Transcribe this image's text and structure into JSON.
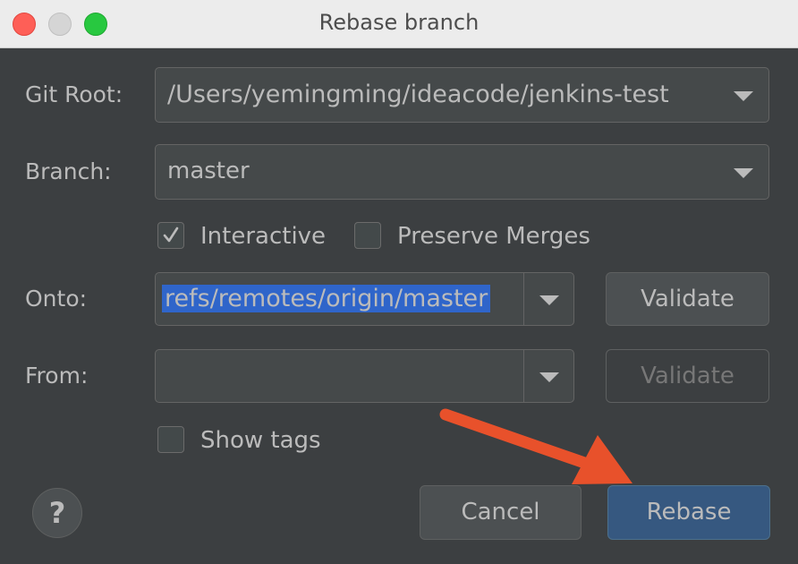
{
  "window": {
    "title": "Rebase branch"
  },
  "git_root": {
    "label": "Git Root:",
    "value": "/Users/yemingming/ideacode/jenkins-test"
  },
  "branch": {
    "label": "Branch:",
    "value": "master"
  },
  "options": {
    "interactive": {
      "label": "Interactive",
      "checked": true
    },
    "preserve_merges": {
      "label": "Preserve Merges",
      "checked": false
    }
  },
  "onto": {
    "label": "Onto:",
    "value": "refs/remotes/origin/master",
    "validate_label": "Validate"
  },
  "from": {
    "label": "From:",
    "value": "",
    "validate_label": "Validate"
  },
  "show_tags": {
    "label": "Show tags",
    "checked": false
  },
  "buttons": {
    "help": "?",
    "cancel": "Cancel",
    "rebase": "Rebase"
  },
  "annotation": {
    "color": "#e8512b",
    "type": "arrow"
  }
}
